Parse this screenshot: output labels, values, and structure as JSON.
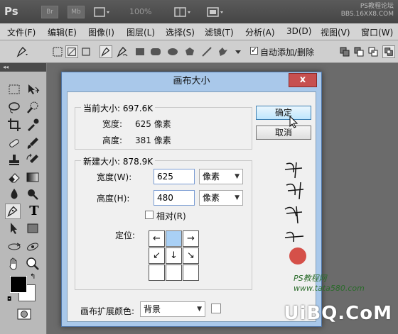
{
  "appbar": {
    "logo": "Ps",
    "br": "Br",
    "mb": "Mb",
    "zoom": "100%",
    "site_line1": "PS教程论坛",
    "site_line2": "BBS.16XX8.COM"
  },
  "menu": {
    "items": [
      "文件(F)",
      "编辑(E)",
      "图像(I)",
      "图层(L)",
      "选择(S)",
      "滤镜(T)",
      "分析(A)",
      "3D(D)",
      "视图(V)",
      "窗口(W)"
    ]
  },
  "options": {
    "auto_add_delete_label": "自动添加/删除",
    "auto_add_delete_checked": "✓"
  },
  "dialog": {
    "title": "画布大小",
    "close": "x",
    "ok": "确定",
    "cancel": "取消",
    "current": {
      "legend": "当前大小: 697.6K",
      "width_label": "宽度:",
      "width_value": "625 像素",
      "height_label": "高度:",
      "height_value": "381 像素"
    },
    "new": {
      "legend": "新建大小: 878.9K",
      "width_label": "宽度(W):",
      "width_value": "625",
      "width_unit": "像素",
      "height_label": "高度(H):",
      "height_value": "480",
      "height_unit": "像素",
      "relative_label": "相对(R)",
      "anchor_label": "定位:"
    },
    "extension": {
      "label": "画布扩展颜色:",
      "value": "背景"
    }
  },
  "overlay": {
    "site": "PS教程网  www.tata580.com",
    "brand": "UiBQ.CoM"
  }
}
